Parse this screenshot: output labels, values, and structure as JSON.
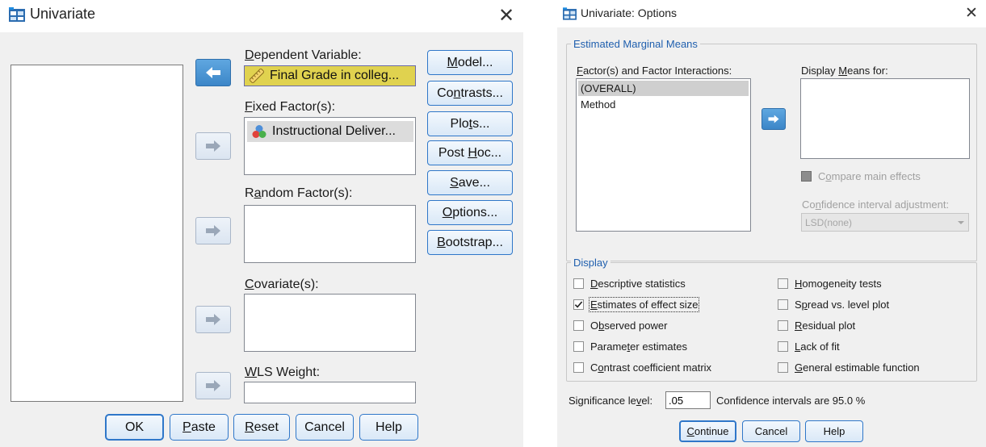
{
  "univariate": {
    "title": "Univariate",
    "close_glyph": "✕",
    "labels": {
      "dependent": {
        "u": "D",
        "rest": "ependent Variable:"
      },
      "fixed": {
        "u": "F",
        "rest": "ixed Factor(s):"
      },
      "random": {
        "pre": "R",
        "u": "a",
        "rest": "ndom Factor(s):"
      },
      "covariate": {
        "u": "C",
        "rest": "ovariate(s):"
      },
      "wls": {
        "u": "W",
        "rest": "LS Weight:"
      }
    },
    "dependent_item": "Final Grade in colleg...",
    "fixed_item": "Instructional Deliver...",
    "side_buttons": [
      {
        "pre": "",
        "u": "M",
        "post": "odel..."
      },
      {
        "pre": "Co",
        "u": "n",
        "post": "trasts..."
      },
      {
        "pre": "Plo",
        "u": "t",
        "post": "s..."
      },
      {
        "pre": "Post ",
        "u": "H",
        "post": "oc..."
      },
      {
        "pre": "",
        "u": "S",
        "post": "ave..."
      },
      {
        "pre": "",
        "u": "O",
        "post": "ptions..."
      },
      {
        "pre": "",
        "u": "B",
        "post": "ootstrap..."
      }
    ],
    "bottom_buttons": {
      "ok": "OK",
      "paste": {
        "u": "P",
        "post": "aste"
      },
      "reset": {
        "u": "R",
        "post": "eset"
      },
      "cancel": "Cancel",
      "help": "Help"
    },
    "icons": {
      "dependent": "scale-ruler-icon",
      "fixed": "nominal-circles-icon",
      "arrow": "right-arrow-icon"
    }
  },
  "options": {
    "title": "Univariate: Options",
    "close_glyph": "✕",
    "emm_group_title": "Estimated Marginal Means",
    "factors_label": {
      "u": "F",
      "rest": "actor(s) and Factor Interactions:"
    },
    "factors": [
      "(OVERALL)",
      "Method"
    ],
    "display_means_label": {
      "pre": "Display ",
      "u": "M",
      "post": "eans for:"
    },
    "compare_main": {
      "pre": "C",
      "u": "o",
      "post": "mpare main effects"
    },
    "ci_adjust_label": {
      "pre": "Co",
      "u": "n",
      "post": "fidence interval adjustment:"
    },
    "ci_adjust_value": "LSD(none)",
    "display_group_title": "Display",
    "checks_left": [
      {
        "pre": "",
        "u": "D",
        "post": "escriptive statistics",
        "checked": false
      },
      {
        "pre": "",
        "u": "E",
        "post": "stimates of effect size",
        "checked": true
      },
      {
        "pre": "O",
        "u": "b",
        "post": "served power",
        "checked": false
      },
      {
        "pre": "Parame",
        "u": "t",
        "post": "er estimates",
        "checked": false
      },
      {
        "pre": "C",
        "u": "o",
        "post": "ntrast coefficient matrix",
        "checked": false
      }
    ],
    "checks_right": [
      {
        "pre": "",
        "u": "H",
        "post": "omogeneity tests",
        "checked": false
      },
      {
        "pre": "S",
        "u": "p",
        "post": "read vs. level plot",
        "checked": false
      },
      {
        "pre": "",
        "u": "R",
        "post": "esidual plot",
        "checked": false
      },
      {
        "pre": "",
        "u": "L",
        "post": "ack of fit",
        "checked": false
      },
      {
        "pre": "",
        "u": "G",
        "post": "eneral estimable function",
        "checked": false
      }
    ],
    "significance_label": {
      "pre": "Significance le",
      "u": "v",
      "post": "el:"
    },
    "significance_value": ".05",
    "ci_text": "Confidence intervals are 95.0 %",
    "buttons": {
      "continue": {
        "u": "C",
        "post": "ontinue"
      },
      "cancel": "Cancel",
      "help": "Help"
    }
  },
  "colors": {
    "accent": "#2f77c9",
    "group_title": "#1f5fae",
    "variable_highlight": "#e0d24f",
    "dialog_bg": "#f0f0f0"
  }
}
